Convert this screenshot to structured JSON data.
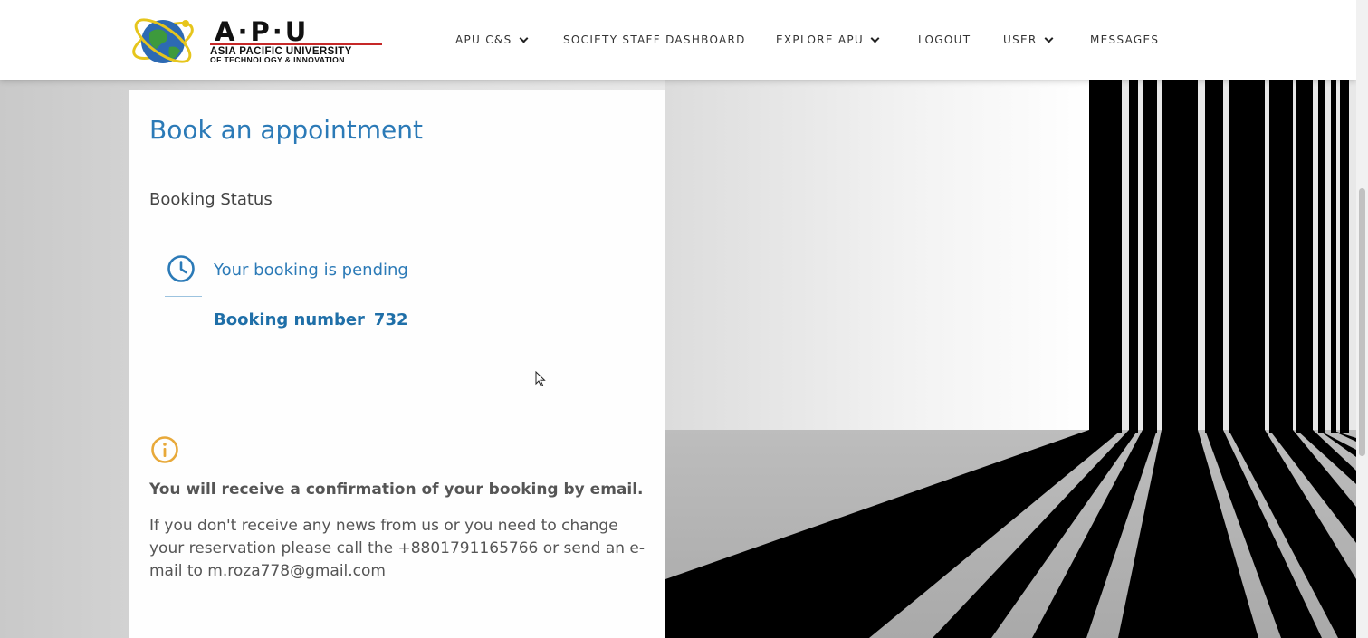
{
  "logo": {
    "brand": "A·P·U",
    "line1": "ASIA PACIFIC UNIVERSITY",
    "line2": "OF TECHNOLOGY & INNOVATION"
  },
  "nav": {
    "items": [
      {
        "label": "APU C&S",
        "has_dropdown": true
      },
      {
        "label": "SOCIETY STAFF DASHBOARD",
        "has_dropdown": false
      },
      {
        "label": "EXPLORE APU",
        "has_dropdown": true
      },
      {
        "label": "LOGOUT",
        "has_dropdown": false
      },
      {
        "label": "USER",
        "has_dropdown": true
      },
      {
        "label": "MESSAGES",
        "has_dropdown": false
      }
    ]
  },
  "card": {
    "title": "Book an appointment",
    "status_label": "Booking Status",
    "status_text": "Your booking is pending",
    "booking_label": "Booking number",
    "booking_number": "732",
    "confirmation": "You will receive a confirmation of your booking by email.",
    "note": "If you don't receive any news from us or you need to change your reservation please call the +8801791165766 or send an e-mail to m.roza778@gmail.com"
  },
  "icons": {
    "status": "clock-icon",
    "info": "info-icon",
    "dropdown": "chevron-down-icon"
  },
  "colors": {
    "accent": "#2b7ab7",
    "info_icon": "#e8a93a",
    "header_bg": "#ffffff"
  }
}
